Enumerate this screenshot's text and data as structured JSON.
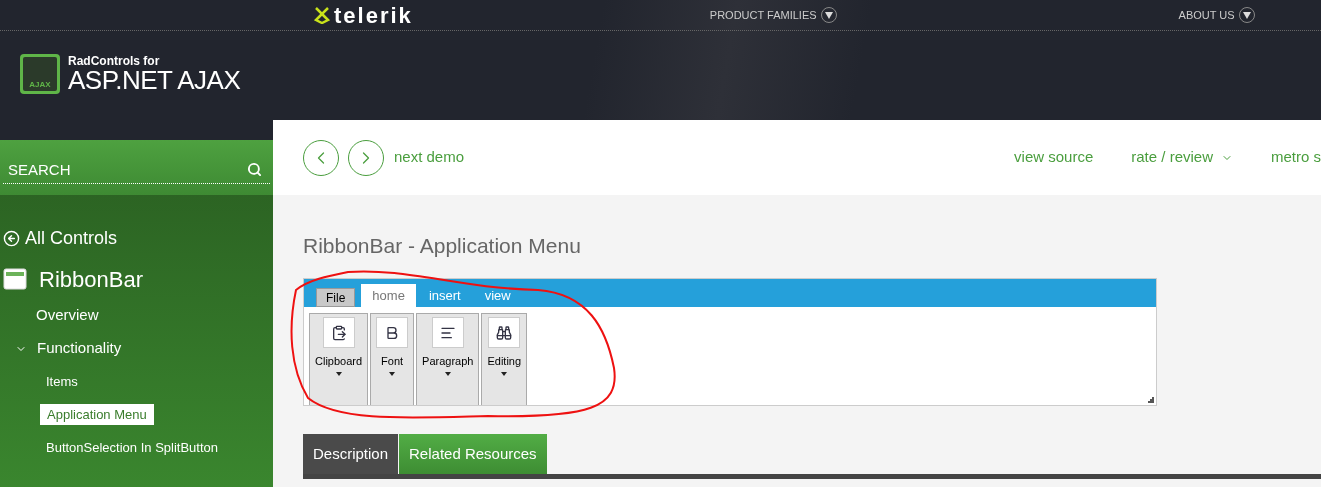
{
  "top_bar": {
    "brand": "telerik",
    "menus": [
      {
        "label": "PRODUCT FAMILIES"
      },
      {
        "label": "ABOUT US"
      }
    ]
  },
  "product_logo": {
    "badge": "AJAX",
    "line1": "RadControls for",
    "line2": "ASP.NET AJAX"
  },
  "sidebar": {
    "search": {
      "placeholder": "SEARCH"
    },
    "back_link": "All Controls",
    "control": {
      "title": "RibbonBar",
      "items": [
        {
          "label": "Overview",
          "selected": false
        },
        {
          "label": "Functionality",
          "expanded": true,
          "selected": false,
          "children": [
            {
              "label": "Items",
              "selected": false
            },
            {
              "label": "Application Menu",
              "selected": true
            },
            {
              "label": "ButtonSelection In SplitButton",
              "selected": false
            }
          ]
        }
      ]
    }
  },
  "demo_nav": {
    "next": "next demo",
    "links": [
      {
        "label": "view source",
        "dropdown": false
      },
      {
        "label": "rate / review",
        "dropdown": true
      },
      {
        "label": "metro s",
        "dropdown": false
      }
    ]
  },
  "page_title": "RibbonBar - Application Menu",
  "ribbon": {
    "tabs": [
      {
        "label": "File",
        "kind": "application-menu",
        "selected": false
      },
      {
        "label": "home",
        "kind": "tab",
        "selected": true
      },
      {
        "label": "insert",
        "kind": "tab",
        "selected": false
      },
      {
        "label": "view",
        "kind": "tab",
        "selected": false
      }
    ],
    "groups": [
      {
        "label": "Clipboard"
      },
      {
        "label": "Font"
      },
      {
        "label": "Paragraph"
      },
      {
        "label": "Editing"
      }
    ]
  },
  "bottom_tabs": [
    {
      "label": "Description",
      "selected": true
    },
    {
      "label": "Related Resources",
      "selected": false
    }
  ]
}
